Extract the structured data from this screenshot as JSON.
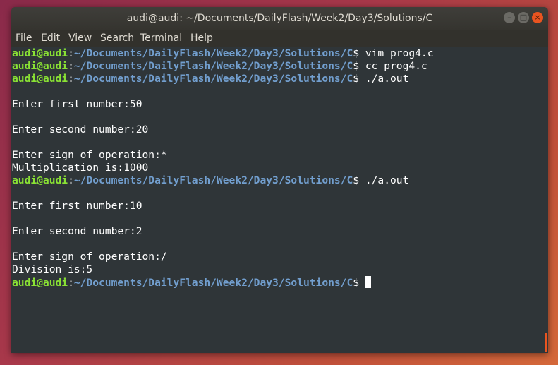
{
  "window": {
    "title": "audi@audi: ~/Documents/DailyFlash/Week2/Day3/Solutions/C",
    "buttons": {
      "minimize": "–",
      "maximize": "□",
      "close": "×"
    }
  },
  "menu": [
    "File",
    "Edit",
    "View",
    "Search",
    "Terminal",
    "Help"
  ],
  "prompt": {
    "user": "audi@audi",
    "separator": ":",
    "path": "~/Documents/DailyFlash/Week2/Day3/Solutions/C",
    "symbol": "$"
  },
  "lines": [
    {
      "type": "prompt",
      "cmd": " vim prog4.c"
    },
    {
      "type": "prompt",
      "cmd": " cc prog4.c"
    },
    {
      "type": "prompt",
      "cmd": " ./a.out"
    },
    {
      "type": "text",
      "text": ""
    },
    {
      "type": "text",
      "text": "Enter first number:50"
    },
    {
      "type": "text",
      "text": ""
    },
    {
      "type": "text",
      "text": "Enter second number:20"
    },
    {
      "type": "text",
      "text": ""
    },
    {
      "type": "text",
      "text": "Enter sign of operation:*"
    },
    {
      "type": "text",
      "text": "Multiplication is:1000"
    },
    {
      "type": "prompt",
      "cmd": " ./a.out"
    },
    {
      "type": "text",
      "text": ""
    },
    {
      "type": "text",
      "text": "Enter first number:10"
    },
    {
      "type": "text",
      "text": ""
    },
    {
      "type": "text",
      "text": "Enter second number:2"
    },
    {
      "type": "text",
      "text": ""
    },
    {
      "type": "text",
      "text": "Enter sign of operation:/"
    },
    {
      "type": "text",
      "text": "Division is:5"
    },
    {
      "type": "prompt",
      "cmd": " ",
      "cursor": true
    }
  ]
}
